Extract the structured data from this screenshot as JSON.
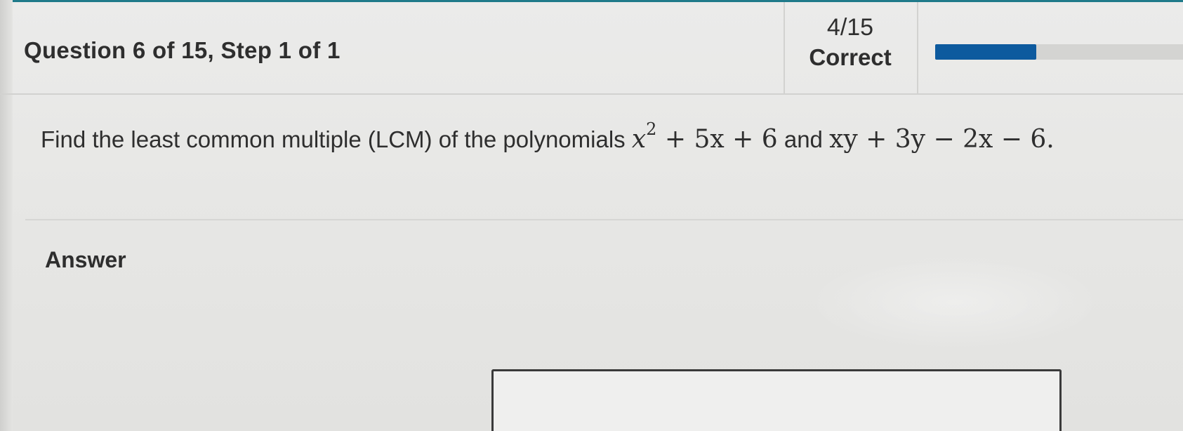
{
  "header": {
    "question_title": "Question 6 of 15, Step 1 of 1",
    "score_fraction": "4/15",
    "score_label": "Correct",
    "progress": {
      "value": 0.4,
      "fill_color": "#0d5a9e",
      "track_color": "#d4d4d2"
    }
  },
  "question": {
    "prompt": "Find the least common multiple (LCM) of the polynomials",
    "conjunction": "and",
    "poly1": {
      "var": "x",
      "exp": "2",
      "rest": "+ 5x + 6"
    },
    "poly2": "xy + 3y − 2x − 6."
  },
  "answer": {
    "label": "Answer",
    "value": ""
  },
  "colors": {
    "accent": "#1f7a8a",
    "text": "#2e2e2e",
    "border": "#3a3a3a"
  }
}
